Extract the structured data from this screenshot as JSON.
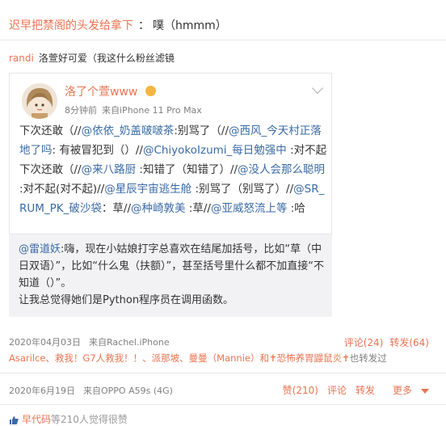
{
  "top_comment": {
    "author": "迟早把禁阁的头发给拿下",
    "text": "噗（hmmm）"
  },
  "reply": {
    "author": "randi",
    "text": "洛萱好可爱（我这什么粉丝滤镜"
  },
  "quoted_post": {
    "name": "洛了个萱www",
    "time": "8分钟前",
    "source": "来自iPhone 11 Pro Max",
    "body_segments": [
      {
        "t": "下次还敢（//",
        "m": false
      },
      {
        "t": "@依依_奶盖啵啵茶",
        "m": true
      },
      {
        "t": ":别骂了（//",
        "m": false
      },
      {
        "t": "@西风_今天村正落地了吗",
        "m": true
      },
      {
        "t": ": 有被冒犯到（）//",
        "m": false
      },
      {
        "t": "@ChiyokoIzumi_每日勉强中",
        "m": true
      },
      {
        "t": " :对不起 下次还敢（//",
        "m": false
      },
      {
        "t": "@来八路厨",
        "m": true
      },
      {
        "t": " :知错了（知错了）//",
        "m": false
      },
      {
        "t": "@没人会那么聪明",
        "m": true
      },
      {
        "t": " :对不起(对不起)//",
        "m": false
      },
      {
        "t": "@星辰宇宙逃生舱",
        "m": true
      },
      {
        "t": " :别骂了（别骂了）//",
        "m": false
      },
      {
        "t": "@SR_RUM_PK_破沙袋",
        "m": true
      },
      {
        "t": "：草//",
        "m": false
      },
      {
        "t": "@种崎敦美",
        "m": true
      },
      {
        "t": " :草//",
        "m": false
      },
      {
        "t": "@亚威怒流上等",
        "m": true
      },
      {
        "t": " :哈",
        "m": false
      }
    ]
  },
  "inner_comment": {
    "mention": "@雷道妖",
    "line1": ":嗨，现在小姑娘打字总喜欢在结尾加括号，比如“草（中日双语）”，比如“什么鬼（扶额）”，甚至括号里什么都不加直接“不知道（）”。",
    "line2": "让我总觉得她们是Python程序员在调用函数。"
  },
  "repost_footer": {
    "date": "2020年04月03日",
    "source": "来自Rachel.iPhone",
    "comments_label": "评论(24)",
    "reposts_label": "转发(64)",
    "reposters": "Asarilce、救我！G7人救我！！、派那坡、曼曼（Mannie）和✝恐怖养胃鼹鼠炎✝",
    "reposters_tail": "也转发过"
  },
  "post_footer": {
    "date": "2020年6月19日",
    "source": "来自OPPO A59s (4G)",
    "like_label": "赞(210)",
    "comment_label": "评论",
    "repost_label": "转发",
    "more_label": "更多"
  },
  "partial_line": {
    "author": "早代码",
    "text": "等210人觉得很赞"
  },
  "colors": {
    "accent": "#eb7350",
    "mention": "#3a6aa5",
    "gray": "#808080",
    "card_bg": "#f2f2f5"
  }
}
